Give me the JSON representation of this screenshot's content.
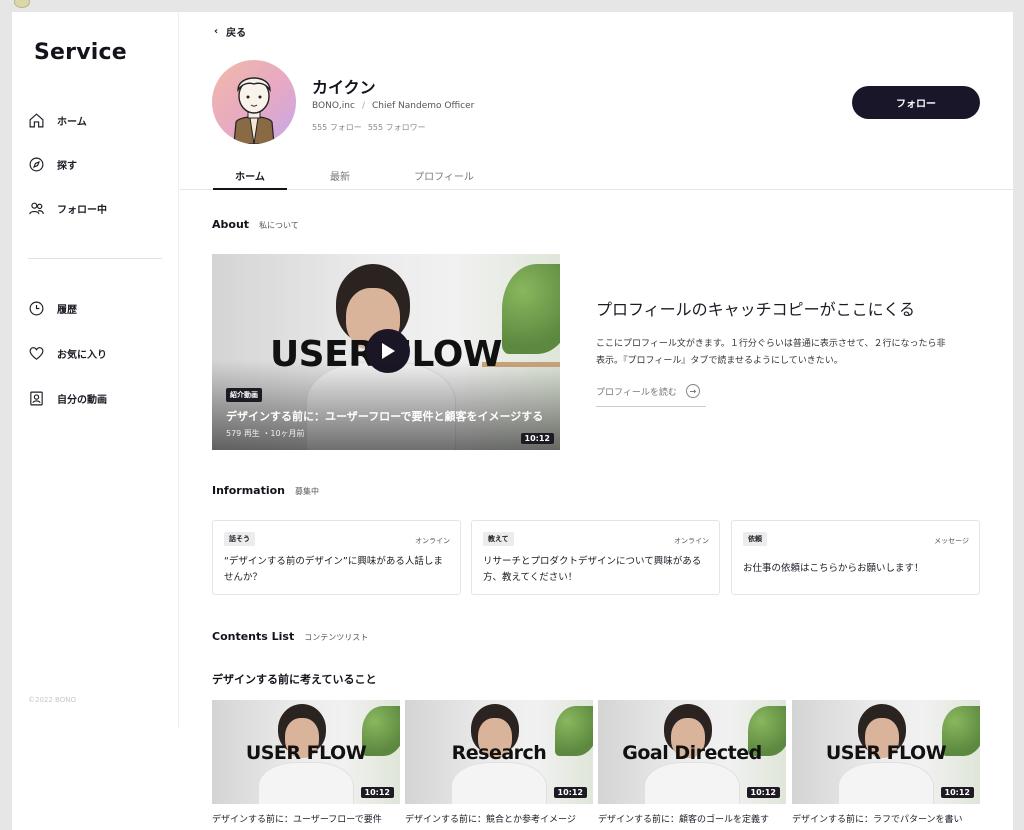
{
  "app": {
    "logo": "Service",
    "copyright": "©2022 BONO"
  },
  "sidebar": {
    "items": [
      {
        "label": "ホーム",
        "icon": "home-icon"
      },
      {
        "label": "探す",
        "icon": "compass-icon"
      },
      {
        "label": "フォロー中",
        "icon": "people-icon"
      },
      {
        "label": "履歴",
        "icon": "clock-icon"
      },
      {
        "label": "お気に入り",
        "icon": "heart-icon"
      },
      {
        "label": "自分の動画",
        "icon": "user-square-icon"
      }
    ]
  },
  "header": {
    "back_label": "戻る"
  },
  "profile": {
    "name": "カイクン",
    "company": "BONO,inc",
    "separator": "/",
    "role": "Chief Nandemo Officer",
    "following": "555 フォロー",
    "followers": "555 フォロワー",
    "follow_button": "フォロー"
  },
  "tabs": [
    {
      "label": "ホーム",
      "active": true
    },
    {
      "label": "最新",
      "active": false
    },
    {
      "label": "プロフィール",
      "active": false
    }
  ],
  "about": {
    "heading": "About",
    "subheading": "私について",
    "video": {
      "thumbnail_text": "USER FLOW",
      "badge": "紹介動画",
      "title": "デザインする前に：ユーザーフローで要件と顧客をイメージする",
      "meta": "579 再生 ・10ヶ月前",
      "duration": "10:12"
    },
    "catchcopy": "プロフィールのキャッチコピーがここにくる",
    "bio": "ここにプロフィール文がきます。１行分ぐらいは普通に表示させて、２行になったら非表示。『プロフィール』タブで読ませるようにしていきたい。",
    "read_more": "プロフィールを読む"
  },
  "information": {
    "heading": "Information",
    "subheading": "募集中",
    "cards": [
      {
        "tag": "話そう",
        "kind": "オンライン",
        "text": "“デザインする前のデザイン”に興味がある人話しませんか？"
      },
      {
        "tag": "教えて",
        "kind": "オンライン",
        "text": "リサーチとプロダクトデザインについて興味がある方、教えてください！"
      },
      {
        "tag": "依頼",
        "kind": "メッセージ",
        "text": "お仕事の依頼はこちらからお願いします！"
      }
    ]
  },
  "contents": {
    "heading": "Contents List",
    "subheading": "コンテンツリスト",
    "playlist_title": "デザインする前に考えていること",
    "items": [
      {
        "thumbnail_text": "USER FLOW",
        "duration": "10:12",
        "caption": "デザインする前に：ユーザーフローで要件"
      },
      {
        "thumbnail_text": "Research",
        "duration": "10:12",
        "caption": "デザインする前に：競合とか参考イメージ"
      },
      {
        "thumbnail_text": "Goal Directed",
        "duration": "10:12",
        "caption": "デザインする前に：顧客のゴールを定義す"
      },
      {
        "thumbnail_text": "USER FLOW",
        "duration": "10:12",
        "caption": "デザインする前に：ラフでパターンを書い"
      }
    ]
  },
  "colors": {
    "accent": "#1a1629",
    "text": "#1d1a24",
    "muted": "#777777"
  }
}
